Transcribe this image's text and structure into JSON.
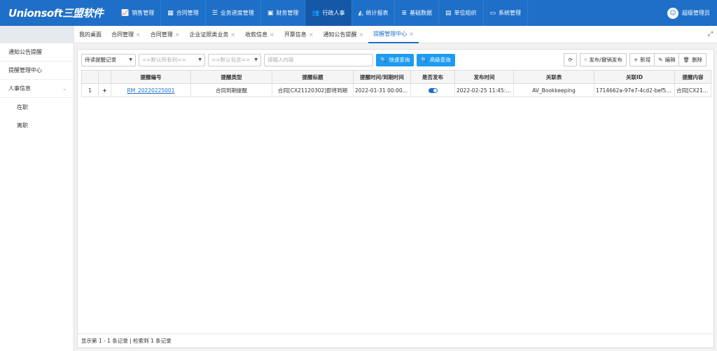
{
  "app": {
    "logo_text": "Unionsoft三盟软件"
  },
  "nav": [
    {
      "label": "销售管理",
      "icon": "chart-icon",
      "glyph": "📈"
    },
    {
      "label": "合同管理",
      "icon": "grid-icon",
      "glyph": "▦"
    },
    {
      "label": "业务进度管理",
      "icon": "sliders-icon",
      "glyph": "☰"
    },
    {
      "label": "财务管理",
      "icon": "money-icon",
      "glyph": "▣"
    },
    {
      "label": "行政人事",
      "icon": "users-icon",
      "glyph": "👥"
    },
    {
      "label": "统计报表",
      "icon": "area-chart-icon",
      "glyph": "◭"
    },
    {
      "label": "基础数据",
      "icon": "database-icon",
      "glyph": "≣"
    },
    {
      "label": "单位组织",
      "icon": "org-icon",
      "glyph": "▤"
    },
    {
      "label": "系统管理",
      "icon": "monitor-icon",
      "glyph": "▭"
    }
  ],
  "nav_active": 4,
  "user": {
    "name": "超级管理员"
  },
  "sidebar": {
    "items": [
      {
        "label": "通知公告提醒"
      },
      {
        "label": "提醒管理中心"
      },
      {
        "label": "人事信息"
      },
      {
        "label": "在职"
      },
      {
        "label": "离职"
      }
    ]
  },
  "tabs": [
    {
      "label": "我的桌面",
      "closable": false
    },
    {
      "label": "合同管理",
      "closable": true
    },
    {
      "label": "合同管理",
      "closable": true
    },
    {
      "label": "企业证照类业务",
      "closable": true
    },
    {
      "label": "收款信息",
      "closable": true
    },
    {
      "label": "开票信息",
      "closable": true
    },
    {
      "label": "通知公告提醒",
      "closable": true
    },
    {
      "label": "提醒管理中心",
      "closable": true
    }
  ],
  "tab_active": 7,
  "filters": {
    "record_type": "待读提醒记录",
    "column": "==默认所有列==",
    "match": "==默认包含==",
    "search_placeholder": "请输入内容",
    "quick_search": "快速查询",
    "advanced_search": "高级查询"
  },
  "toolbar": {
    "publish": "发布/撤销发布",
    "add": "新增",
    "edit": "编辑",
    "delete": "删除"
  },
  "table": {
    "headers": [
      "提醒编号",
      "提醒类型",
      "提醒标题",
      "提醒时间/到期时间",
      "是否发布",
      "发布时间",
      "关联表",
      "关联ID",
      "提醒内容"
    ],
    "rows": [
      {
        "index": "1",
        "code": "RM_20220225001",
        "type": "合同到期提醒",
        "title": "合同[CX21120302]即将到期",
        "time": "2022-01-31 00:00:00",
        "published": true,
        "publish_time": "2022-02-25 11:45:48",
        "table": "AV_Bookkeeping",
        "ref_id": "1714662a-97e7-4cd2-bef5-f...",
        "content": "合同[CX21120..."
      }
    ]
  },
  "footer": {
    "text": "显示第 1 - 1 条记录 | 检索到 1 条记录"
  }
}
